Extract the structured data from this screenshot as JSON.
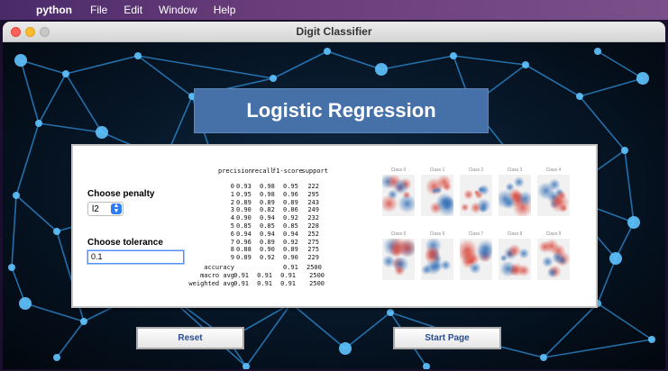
{
  "menubar": {
    "apple_icon": "apple-icon",
    "app_name": "python",
    "items": [
      "File",
      "Edit",
      "Window",
      "Help"
    ]
  },
  "window": {
    "title": "Digit Classifier"
  },
  "header": {
    "title": "Logistic Regression"
  },
  "controls": {
    "penalty_label": "Choose penalty",
    "penalty_value": "l2",
    "tolerance_label": "Choose tolerance",
    "tolerance_value": "0.1"
  },
  "report": {
    "headers": [
      "precision",
      "recall",
      "f1-score",
      "support"
    ],
    "rows": [
      {
        "label": "0",
        "precision": "0.93",
        "recall": "0.98",
        "f1": "0.95",
        "support": "222"
      },
      {
        "label": "1",
        "precision": "0.95",
        "recall": "0.98",
        "f1": "0.96",
        "support": "295"
      },
      {
        "label": "2",
        "precision": "0.89",
        "recall": "0.89",
        "f1": "0.89",
        "support": "243"
      },
      {
        "label": "3",
        "precision": "0.90",
        "recall": "0.82",
        "f1": "0.86",
        "support": "249"
      },
      {
        "label": "4",
        "precision": "0.90",
        "recall": "0.94",
        "f1": "0.92",
        "support": "232"
      },
      {
        "label": "5",
        "precision": "0.85",
        "recall": "0.85",
        "f1": "0.85",
        "support": "228"
      },
      {
        "label": "6",
        "precision": "0.94",
        "recall": "0.94",
        "f1": "0.94",
        "support": "252"
      },
      {
        "label": "7",
        "precision": "0.96",
        "recall": "0.89",
        "f1": "0.92",
        "support": "275"
      },
      {
        "label": "8",
        "precision": "0.88",
        "recall": "0.90",
        "f1": "0.89",
        "support": "275"
      },
      {
        "label": "9",
        "precision": "0.89",
        "recall": "0.92",
        "f1": "0.90",
        "support": "229"
      }
    ],
    "accuracy": {
      "label": "accuracy",
      "f1": "0.91",
      "support": "2500"
    },
    "averages": [
      {
        "label": "macro avg",
        "precision": "0.91",
        "recall": "0.91",
        "f1": "0.91",
        "support": "2500"
      },
      {
        "label": "weighted avg",
        "precision": "0.91",
        "recall": "0.91",
        "f1": "0.91",
        "support": "2500"
      }
    ]
  },
  "class_images": [
    {
      "name": "Class 0"
    },
    {
      "name": "Class 1"
    },
    {
      "name": "Class 2"
    },
    {
      "name": "Class 3"
    },
    {
      "name": "Class 4"
    },
    {
      "name": "Class 5"
    },
    {
      "name": "Class 6"
    },
    {
      "name": "Class 7"
    },
    {
      "name": "Class 8"
    },
    {
      "name": "Class 9"
    }
  ],
  "buttons": {
    "reset_label": "Reset",
    "start_page_label": "Start Page"
  },
  "colors": {
    "banner": "#4670a8",
    "positive_weight": "#d9453a",
    "negative_weight": "#2f6db6",
    "button_text": "#2b4d8e"
  }
}
